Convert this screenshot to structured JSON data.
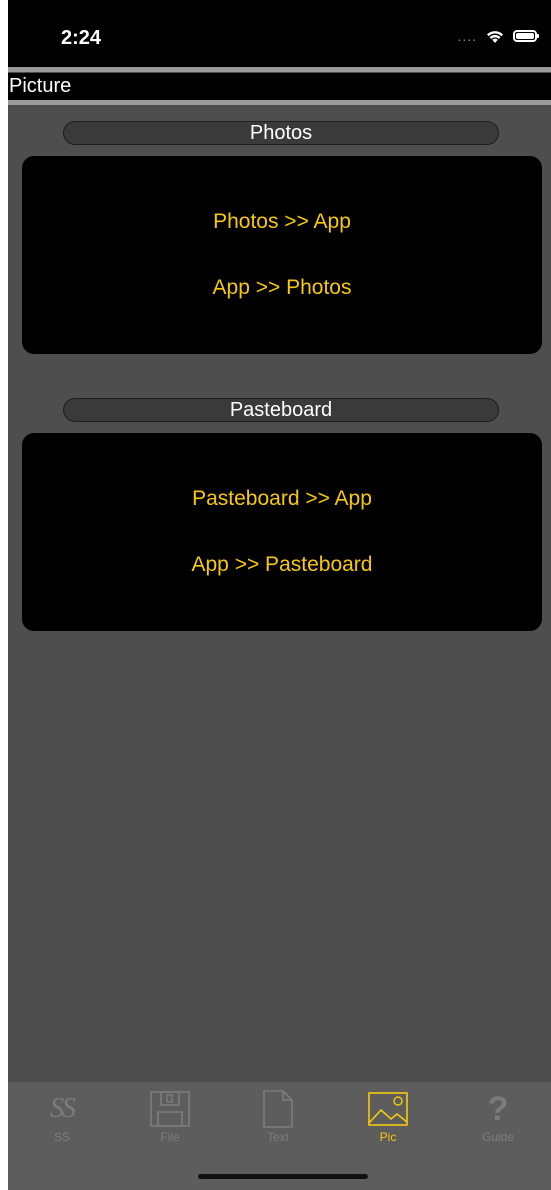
{
  "status_bar": {
    "time": "2:24",
    "signal": "....",
    "wifi_icon": "wifi-icon",
    "battery_icon": "battery-icon"
  },
  "title_bar": {
    "title": "Picture"
  },
  "sections": [
    {
      "header": "Photos",
      "buttons": [
        "Photos >> App",
        "App >> Photos"
      ]
    },
    {
      "header": "Pasteboard",
      "buttons": [
        "Pasteboard >> App",
        "App >> Pasteboard"
      ]
    }
  ],
  "tab_bar": {
    "tabs": [
      {
        "label": "SS",
        "icon": "ss-icon",
        "glyph": "SS",
        "active": false
      },
      {
        "label": "File",
        "icon": "floppy-disk-icon",
        "active": false
      },
      {
        "label": "Text",
        "icon": "document-icon",
        "active": false
      },
      {
        "label": "Pic",
        "icon": "picture-icon",
        "active": true
      },
      {
        "label": "Guide",
        "icon": "question-mark-icon",
        "glyph": "?",
        "active": false
      }
    ]
  },
  "colors": {
    "accent": "#f7c90a",
    "background": "#4e4e4e",
    "panel": "#000000",
    "inactive_tab": "#7c7c7c"
  }
}
